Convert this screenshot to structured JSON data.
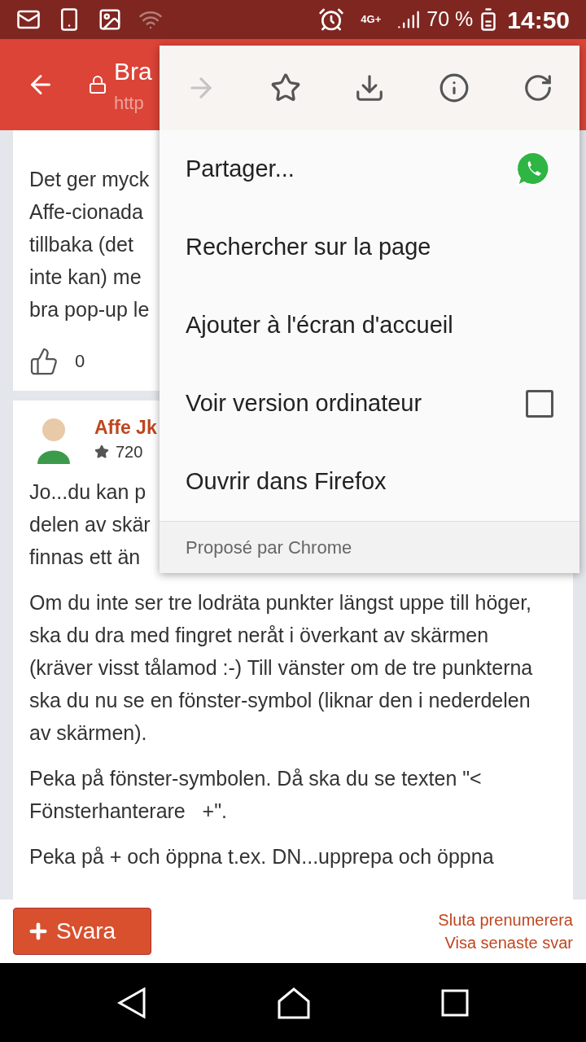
{
  "status_bar": {
    "network": "4G+",
    "battery": "70 %",
    "time": "14:50"
  },
  "toolbar": {
    "title": "Bra",
    "url": "http"
  },
  "posts": [
    {
      "lines": [
        "Det ger myck",
        "Affe-cionada",
        "tillbaka (det",
        "inte kan) me",
        "bra pop-up le"
      ],
      "likes": "0"
    },
    {
      "author": "Affe Jk",
      "score": "720",
      "lines": [
        "Jo...du kan p",
        "delen av skär",
        "finnas ett än"
      ],
      "paragraphs": [
        "Om du inte ser tre lodräta punkter längst uppe till höger, ska du dra med fingret neråt i överkant av skärmen (kräver visst tålamod :-) Till vänster om de tre punkterna ska du nu se en fönster-symbol (liknar den i nederdelen av skärmen).",
        "Peka på fönster-symbolen. Då ska du se texten \"< Fönsterhanterare   +\".",
        "Peka på + och öppna t.ex. DN...upprepa och öppna"
      ]
    }
  ],
  "bottom_bar": {
    "reply_button": "Svara",
    "links": [
      "Sluta prenumerera",
      "Visa senaste svar"
    ]
  },
  "menu": {
    "icons": [
      {
        "kind": "forward",
        "disabled": true
      },
      {
        "kind": "star",
        "disabled": false
      },
      {
        "kind": "download",
        "disabled": false
      },
      {
        "kind": "info",
        "disabled": false
      },
      {
        "kind": "refresh",
        "disabled": false
      }
    ],
    "items": [
      {
        "kind": "share",
        "label": "Partager..."
      },
      {
        "kind": "plain",
        "label": "Rechercher sur la page"
      },
      {
        "kind": "plain",
        "label": "Ajouter à l'écran d'accueil"
      },
      {
        "kind": "checkbox",
        "label": "Voir version ordinateur",
        "checked": false
      },
      {
        "kind": "plain",
        "label": "Ouvrir dans Firefox"
      }
    ],
    "footer": "Proposé par Chrome"
  }
}
